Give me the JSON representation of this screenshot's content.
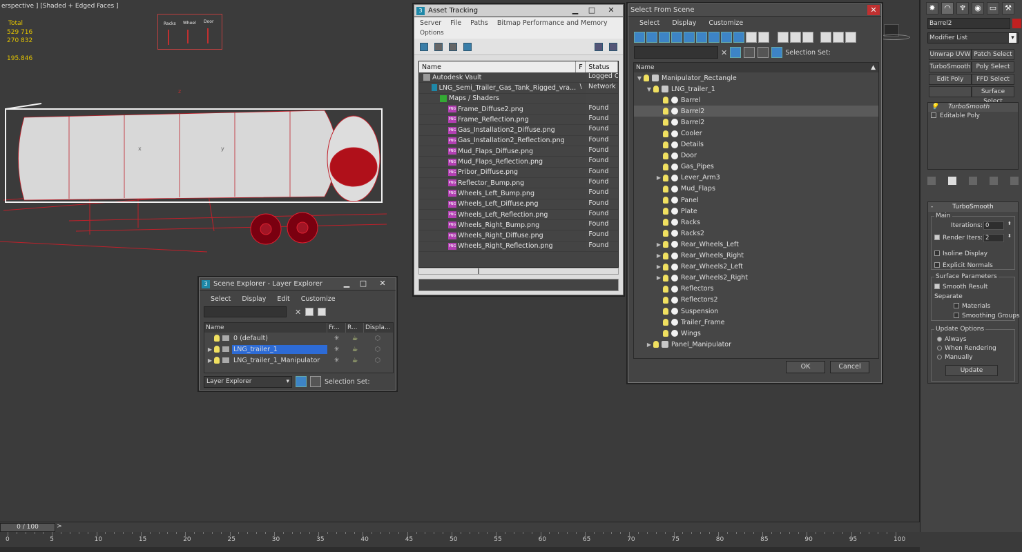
{
  "viewport": {
    "label": "erspective ] [Shaded + Edged Faces ]",
    "stats": {
      "total_label": "Total",
      "polys": "529 716",
      "verts": "270 832",
      "fps": "195.846"
    },
    "manipulator_labels": [
      "Racks",
      "Wheel",
      "Door"
    ],
    "axis": {
      "x": "x",
      "y": "y",
      "z": "z"
    }
  },
  "asset_tracking": {
    "title": "Asset Tracking",
    "menu": [
      "Server",
      "File",
      "Paths",
      "Bitmap Performance and Memory",
      "Options"
    ],
    "columns": {
      "name": "Name",
      "flag": "F",
      "status": "Status"
    },
    "rows": [
      {
        "name": "Autodesk Vault",
        "flag": "",
        "status": "Logged O",
        "indent": 0,
        "icon": "vault"
      },
      {
        "name": "LNG_Semi_Trailer_Gas_Tank_Rigged_vra...",
        "flag": "\\",
        "status": "Network P",
        "indent": 1,
        "icon": "max"
      },
      {
        "name": "Maps / Shaders",
        "flag": "",
        "status": "",
        "indent": 2,
        "icon": "maps"
      },
      {
        "name": "Frame_Diffuse2.png",
        "flag": "",
        "status": "Found",
        "indent": 3,
        "icon": "png"
      },
      {
        "name": "Frame_Reflection.png",
        "flag": "",
        "status": "Found",
        "indent": 3,
        "icon": "png"
      },
      {
        "name": "Gas_Installation2_Diffuse.png",
        "flag": "",
        "status": "Found",
        "indent": 3,
        "icon": "png"
      },
      {
        "name": "Gas_Installation2_Reflection.png",
        "flag": "",
        "status": "Found",
        "indent": 3,
        "icon": "png"
      },
      {
        "name": "Mud_Flaps_Diffuse.png",
        "flag": "",
        "status": "Found",
        "indent": 3,
        "icon": "png"
      },
      {
        "name": "Mud_Flaps_Reflection.png",
        "flag": "",
        "status": "Found",
        "indent": 3,
        "icon": "png"
      },
      {
        "name": "Pribor_Diffuse.png",
        "flag": "",
        "status": "Found",
        "indent": 3,
        "icon": "png"
      },
      {
        "name": "Reflector_Bump.png",
        "flag": "",
        "status": "Found",
        "indent": 3,
        "icon": "png"
      },
      {
        "name": "Wheels_Left_Bump.png",
        "flag": "",
        "status": "Found",
        "indent": 3,
        "icon": "png"
      },
      {
        "name": "Wheels_Left_Diffuse.png",
        "flag": "",
        "status": "Found",
        "indent": 3,
        "icon": "png"
      },
      {
        "name": "Wheels_Left_Reflection.png",
        "flag": "",
        "status": "Found",
        "indent": 3,
        "icon": "png"
      },
      {
        "name": "Wheels_Right_Bump.png",
        "flag": "",
        "status": "Found",
        "indent": 3,
        "icon": "png"
      },
      {
        "name": "Wheels_Right_Diffuse.png",
        "flag": "",
        "status": "Found",
        "indent": 3,
        "icon": "png"
      },
      {
        "name": "Wheels_Right_Reflection.png",
        "flag": "",
        "status": "Found",
        "indent": 3,
        "icon": "png"
      }
    ]
  },
  "select_from_scene": {
    "title": "Select From Scene",
    "menu": [
      "Select",
      "Display",
      "Customize"
    ],
    "selection_set_label": "Selection Set:",
    "column_name": "Name",
    "tree": [
      {
        "name": "Manipulator_Rectangle",
        "depth": 0,
        "expander": "open",
        "selected": false
      },
      {
        "name": "LNG_trailer_1",
        "depth": 1,
        "expander": "open",
        "selected": false
      },
      {
        "name": "Barrel",
        "depth": 2,
        "expander": "",
        "selected": false
      },
      {
        "name": "Barrel2",
        "depth": 2,
        "expander": "",
        "selected": true
      },
      {
        "name": "Barrel2",
        "depth": 2,
        "expander": "",
        "selected": false
      },
      {
        "name": "Cooler",
        "depth": 2,
        "expander": "",
        "selected": false
      },
      {
        "name": "Details",
        "depth": 2,
        "expander": "",
        "selected": false
      },
      {
        "name": "Door",
        "depth": 2,
        "expander": "",
        "selected": false
      },
      {
        "name": "Gas_Pipes",
        "depth": 2,
        "expander": "",
        "selected": false
      },
      {
        "name": "Lever_Arm3",
        "depth": 2,
        "expander": "closed",
        "selected": false
      },
      {
        "name": "Mud_Flaps",
        "depth": 2,
        "expander": "",
        "selected": false
      },
      {
        "name": "Panel",
        "depth": 2,
        "expander": "",
        "selected": false
      },
      {
        "name": "Plate",
        "depth": 2,
        "expander": "",
        "selected": false
      },
      {
        "name": "Racks",
        "depth": 2,
        "expander": "",
        "selected": false
      },
      {
        "name": "Racks2",
        "depth": 2,
        "expander": "",
        "selected": false
      },
      {
        "name": "Rear_Wheels_Left",
        "depth": 2,
        "expander": "closed",
        "selected": false
      },
      {
        "name": "Rear_Wheels_Right",
        "depth": 2,
        "expander": "closed",
        "selected": false
      },
      {
        "name": "Rear_Wheels2_Left",
        "depth": 2,
        "expander": "closed",
        "selected": false
      },
      {
        "name": "Rear_Wheels2_Right",
        "depth": 2,
        "expander": "closed",
        "selected": false
      },
      {
        "name": "Reflectors",
        "depth": 2,
        "expander": "",
        "selected": false
      },
      {
        "name": "Reflectors2",
        "depth": 2,
        "expander": "",
        "selected": false
      },
      {
        "name": "Suspension",
        "depth": 2,
        "expander": "",
        "selected": false
      },
      {
        "name": "Trailer_Frame",
        "depth": 2,
        "expander": "",
        "selected": false
      },
      {
        "name": "Wings",
        "depth": 2,
        "expander": "",
        "selected": false
      },
      {
        "name": "Panel_Manipulator",
        "depth": 1,
        "expander": "closed",
        "selected": false
      }
    ],
    "ok_label": "OK",
    "cancel_label": "Cancel"
  },
  "scene_explorer": {
    "title": "Scene Explorer - Layer Explorer",
    "menu": [
      "Select",
      "Display",
      "Edit",
      "Customize"
    ],
    "columns": [
      "Name",
      "Fr...",
      "R...",
      "Displa..."
    ],
    "layers": [
      {
        "name": "0 (default)",
        "expander": "",
        "selected": false
      },
      {
        "name": "LNG_trailer_1",
        "expander": "closed",
        "selected": true
      },
      {
        "name": "LNG_trailer_1_Manipulator",
        "expander": "closed",
        "selected": false
      }
    ],
    "explorer_dropdown": "Layer Explorer",
    "selection_set_label": "Selection Set:"
  },
  "command_panel": {
    "object_name": "Barrel2",
    "object_color": "#c02020",
    "modifier_list_label": "Modifier List",
    "buttons": [
      "Unwrap UVW",
      "Patch Select",
      "TurboSmooth",
      "Poly Select",
      "Edit Poly",
      "FFD Select",
      "",
      "Surface Select"
    ],
    "stack": [
      "TurboSmooth",
      "Editable Poly"
    ],
    "rollout_title": "TurboSmooth",
    "main_label": "Main",
    "iterations_label": "Iterations:",
    "iterations_value": "0",
    "render_iters_label": "Render Iters:",
    "render_iters_value": "2",
    "isoline_label": "Isoline Display",
    "explicit_normals_label": "Explicit Normals",
    "surface_params_label": "Surface Parameters",
    "smooth_result_label": "Smooth Result",
    "separate_label": "Separate",
    "materials_label": "Materials",
    "smoothing_groups_label": "Smoothing Groups",
    "update_options_label": "Update Options",
    "always_label": "Always",
    "when_rendering_label": "When Rendering",
    "manually_label": "Manually",
    "update_button": "Update"
  },
  "timeline": {
    "frame_readout": "0 / 100",
    "next_arrow": ">",
    "ticks": [
      "0",
      "5",
      "10",
      "15",
      "20",
      "25",
      "30",
      "35",
      "40",
      "45",
      "50",
      "55",
      "60",
      "65",
      "70",
      "75",
      "80",
      "85",
      "90",
      "95",
      "100"
    ]
  }
}
